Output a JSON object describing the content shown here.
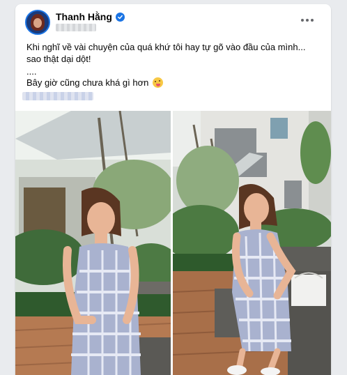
{
  "post": {
    "author": "Thanh Hằng",
    "verified": true,
    "text_lines": [
      "Khi nghĩ về vài chuyện của quá khứ tôi hay tự gõ vào đầu của mình...",
      "sao thật dại dột!",
      "....",
      "Bây giờ cũng chưa khá gì hơn"
    ]
  },
  "icons": {
    "verified": "verified-badge-icon",
    "more": "more-options-icon",
    "emoji": "winking-tongue-emoji-icon"
  },
  "colors": {
    "accent": "#1b74e4",
    "card": "#ffffff",
    "background": "#e9ebee"
  }
}
